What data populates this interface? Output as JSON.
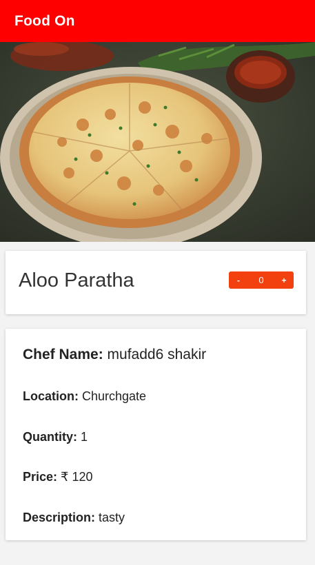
{
  "appbar": {
    "title": "Food On"
  },
  "hero": {
    "image": "pizza-photo"
  },
  "dish": {
    "name": "Aloo Paratha",
    "stepper": {
      "minus": "-",
      "value": "0",
      "plus": "+"
    }
  },
  "details": {
    "chef_label": "Chef Name:",
    "chef_value": "mufadd6 shakir",
    "location_label": "Location:",
    "location_value": "Churchgate",
    "quantity_label": "Quantity:",
    "quantity_value": "1",
    "price_label": "Price:",
    "price_value": "₹ 120",
    "description_label": "Description:",
    "description_value": "tasty"
  },
  "colors": {
    "appbar": "#fe0000",
    "stepper": "#f2410f"
  }
}
